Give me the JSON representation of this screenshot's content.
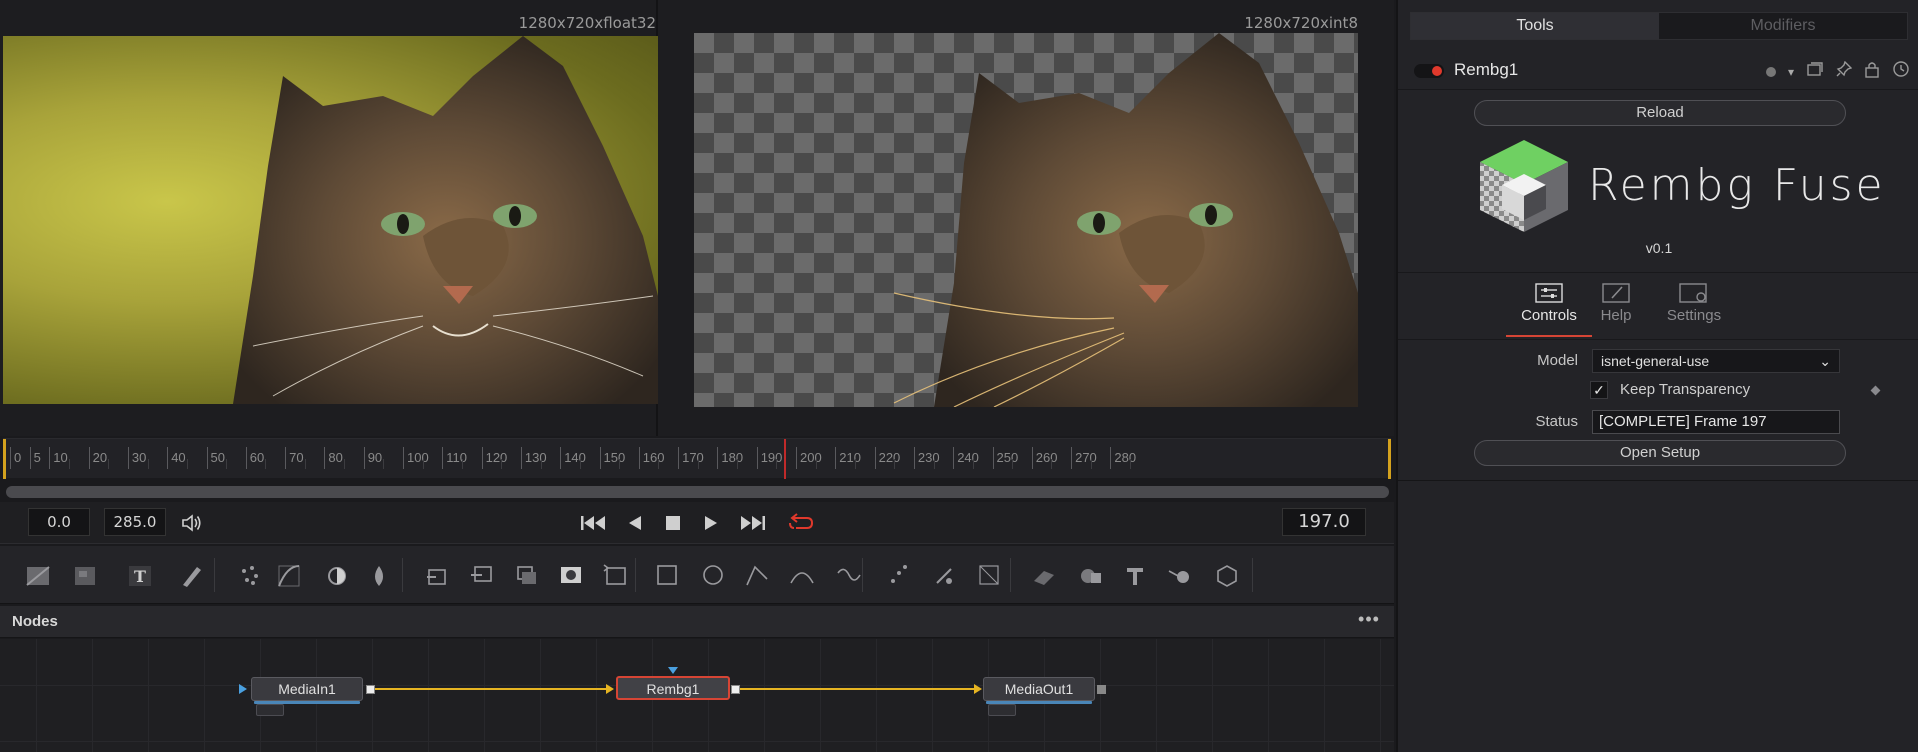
{
  "viewers": {
    "left_resolution": "1280x720xfloat32",
    "right_resolution": "1280x720xint8"
  },
  "timeline": {
    "ticks": [
      "0",
      "5",
      "10",
      "20",
      "30",
      "40",
      "50",
      "60",
      "70",
      "80",
      "90",
      "100",
      "110",
      "120",
      "130",
      "140",
      "150",
      "160",
      "170",
      "180",
      "190",
      "200",
      "210",
      "220",
      "230",
      "240",
      "250",
      "260",
      "270",
      "280"
    ],
    "playhead_frame": 197,
    "range_start": 0,
    "range_end": 285
  },
  "transport": {
    "start_value": "0.0",
    "end_value": "285.0",
    "current_frame": "197.0",
    "icons": [
      "speaker-icon",
      "skip-to-start-icon",
      "play-reverse-icon",
      "stop-icon",
      "play-icon",
      "skip-to-end-icon",
      "loop-icon"
    ]
  },
  "toolbar": {
    "tools": [
      "background-tool-icon",
      "fast-noise-tool-icon",
      "text-tool-icon",
      "paint-tool-icon",
      "particles-tool-icon",
      "color-curves-tool-icon",
      "brightness-contrast-tool-icon",
      "blur-tool-icon",
      "merge-tool-icon",
      "channel-booleans-tool-icon",
      "matte-control-tool-icon",
      "transform-tool-icon",
      "resize-tool-icon",
      "rectangle-mask-icon",
      "ellipse-mask-icon",
      "polygon-mask-icon",
      "bspline-mask-icon",
      "pen-mask-icon",
      "p-emitter-icon",
      "p-render-icon",
      "p-merge-icon",
      "shape-3d-icon",
      "merge-3d-icon",
      "text-3d-icon",
      "renderer-3d-icon",
      "camera-3d-icon"
    ]
  },
  "nodes": {
    "title": "Nodes",
    "menu": "•••",
    "items": [
      {
        "label": "MediaIn1"
      },
      {
        "label": "Rembg1"
      },
      {
        "label": "MediaOut1"
      }
    ]
  },
  "panel": {
    "tabs": {
      "tools": "Tools",
      "modifiers": "Modifiers"
    },
    "tool_name": "Rembg1",
    "reload_label": "Reload",
    "logo_title": "Rembg Fuse",
    "version": "v0.1",
    "sections": {
      "controls": "Controls",
      "help": "Help",
      "settings": "Settings"
    },
    "model_label": "Model",
    "model_value": "isnet-general-use",
    "keep_transparency_label": "Keep Transparency",
    "keep_transparency_checked": "✓",
    "status_label": "Status",
    "status_value": "[COMPLETE] Frame 197",
    "open_setup_label": "Open Setup"
  },
  "colors": {
    "accent_red": "#d64535",
    "link_yellow": "#e6b422",
    "node_bar_blue": "#4a86b8"
  }
}
